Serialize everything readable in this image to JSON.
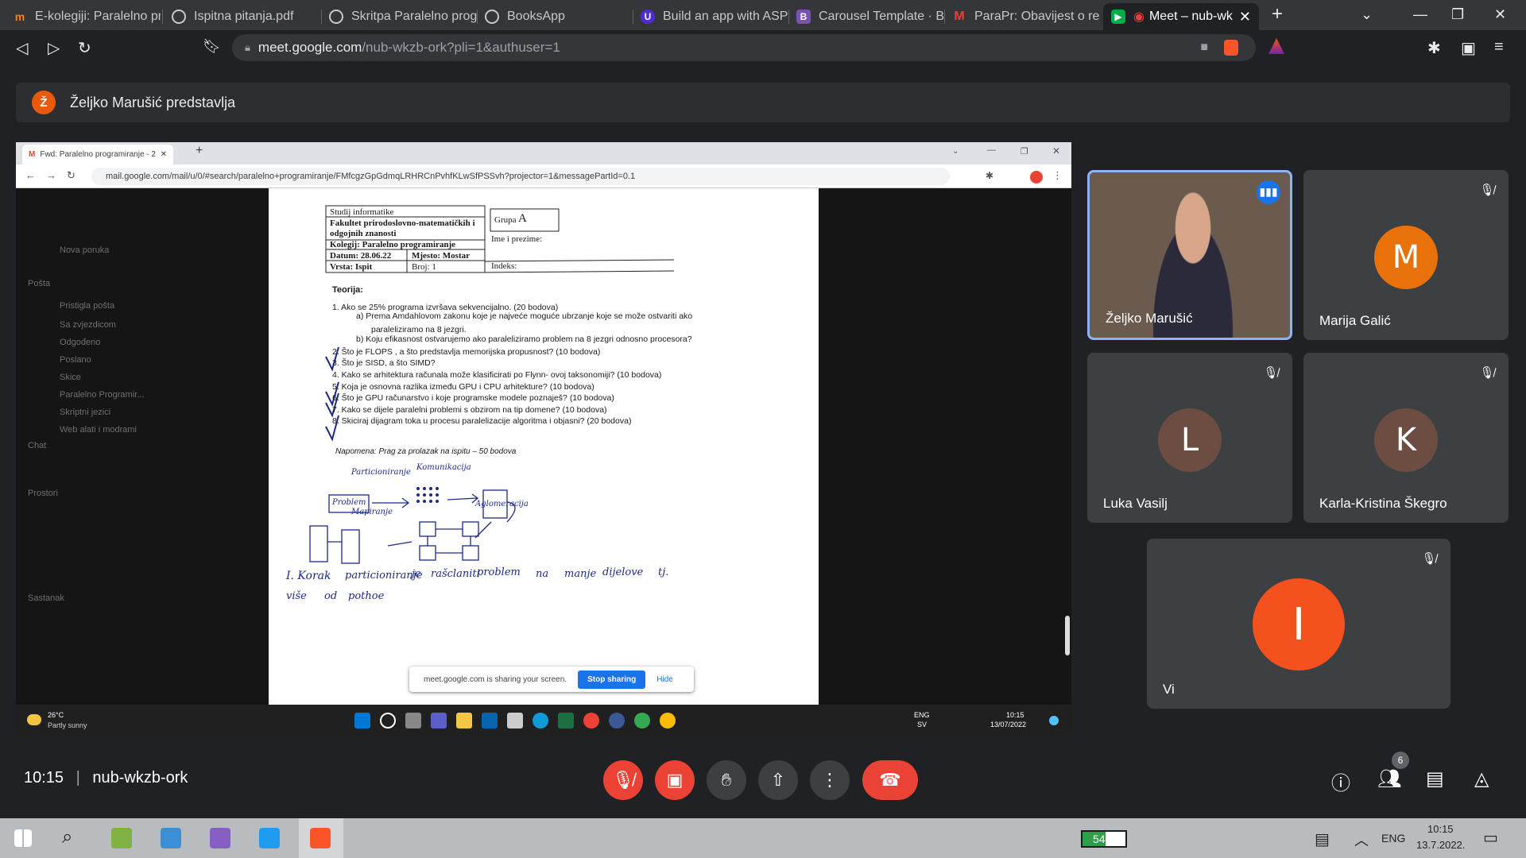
{
  "browser": {
    "tabs": [
      {
        "label": "E-kolegiji: Paralelno pro",
        "icon": "moodle-icon",
        "color": "#f98012"
      },
      {
        "label": "Ispitna pitanja.pdf",
        "icon": "globe-icon",
        "color": "#9aa0a6"
      },
      {
        "label": "Skritpa Paralelno progr",
        "icon": "globe-icon",
        "color": "#9aa0a6"
      },
      {
        "label": "BooksApp",
        "icon": "globe-icon",
        "color": "#9aa0a6"
      },
      {
        "label": "Build an app with ASPN",
        "icon": "dotnet-icon",
        "color": "#512bd4"
      },
      {
        "label": "Carousel Template · Bo",
        "icon": "bootstrap-icon",
        "color": "#7952b3"
      },
      {
        "label": "ParaPr: Obavijest o rez",
        "icon": "gmail-icon",
        "color": "#ea4335"
      },
      {
        "label": "Meet – nub-wk",
        "icon": "meet-icon",
        "color": "#00ac47"
      }
    ],
    "url_host": "meet.google.com",
    "url_path": "/nub-wkzb-ork?pli=1&authuser=1"
  },
  "meet": {
    "presenter_initial": "Ž",
    "presenter_text": "Željko Marušić predstavlja",
    "time": "10:15",
    "separator": "|",
    "code": "nub-wkzb-ork",
    "participants_count": "6",
    "tiles": [
      {
        "name": "Željko Marušić",
        "initial": "",
        "color": "",
        "speaking": true
      },
      {
        "name": "Marija Galić",
        "initial": "M",
        "color": "#e8710a"
      },
      {
        "name": "Luka Vasilj",
        "initial": "L",
        "color": "#6d4c41"
      },
      {
        "name": "Karla-Kristina Škegro",
        "initial": "K",
        "color": "#6d4c41"
      },
      {
        "name": "Vi",
        "initial": "I",
        "color": "#f4511e"
      }
    ]
  },
  "shared": {
    "tab_title": "Fwd: Paralelno programiranje - 2",
    "url": "mail.google.com/mail/u/0/#search/paralelno+programiranje/FMfcgzGpGdmqLRHRCnPvhfKLwSfPSSvh?projector=1&messagePartId=0.1",
    "gmail_items": [
      "Nova poruka",
      "Pošta",
      "Pristigla pošta",
      "Sa zvjezdicom",
      "Odgođeno",
      "Poslano",
      "Skice",
      "Paralelno Programir...",
      "Skriptni jezici",
      "Web alati i modrami",
      "Chat",
      "Prostori",
      "Sastanak"
    ],
    "doc": {
      "header": [
        "Studij informatike",
        "Fakultet prirodoslovno-matematičkih i",
        "odgojnih znanosti",
        "Kolegij: Paralelno programiranje",
        "Datum: 28.06.22",
        "Mjesto: Mostar",
        "Vrsta: Ispit",
        "Broj: 1",
        "Grupa",
        "A",
        "Ime i prezime:",
        "Indeks:"
      ],
      "section": "Teorija:",
      "questions": [
        "1.   Ako se  25% programa izvršava sekvencijalno.  (20 bodova)",
        "a)   Prema Amdahlovom zakonu koje je najveće moguće ubrzanje koje se može ostvariti ako",
        "paraleliziramo na 8  jezgri.",
        "b)   Koju  efikasnost ostvarujemo ako paraleliziramo problem na 8 jezgri odnosno procesora?",
        "2.   Što je FLOPS , a što predstavlja memorijska propusnost? (10 bodova)",
        "3.   Što je SISD, a što SIMD?",
        "4.   Kako se arhitektura računala može klasificirati po Flynn- ovoj taksonomiji?  (10 bodova)",
        "5.   Koja je osnovna razlika između GPU i CPU arhitekture? (10 bodova)",
        "6.   Što je GPU računarstvo i koje programske modele poznaješ?  (10 bodova)",
        "7.   Kako se dijele paralelni problemi s obzirom na tip domene? (10 bodova)",
        "8.   Skiciraj dijagram toka u procesu paralelizacije algoritma i objasni? (20 bodova)"
      ],
      "note": "Napomena: Prag za prolazak na ispitu – 50 bodova",
      "hand": [
        "Particioniranje",
        "Komunikacija",
        "Problem",
        "Aglomeracija",
        "Mapiranje",
        "I. Korak",
        "particioniranje",
        "je",
        "rašclaniti",
        "problem",
        "na",
        "manje",
        "dijelove",
        "tj.",
        "više",
        "od",
        "pothoe"
      ]
    },
    "share_msg": "meet.google.com is sharing your screen.",
    "stop": "Stop sharing",
    "hide": "Hide",
    "weather_temp": "26°C",
    "weather_text": "Partly sunny",
    "lang1": "ENG",
    "lang2": "SV",
    "clock_time": "10:15",
    "clock_date": "13/07/2022"
  },
  "taskbar": {
    "battery": "54%",
    "lang": "ENG",
    "time": "10:15",
    "date": "13.7.2022."
  }
}
